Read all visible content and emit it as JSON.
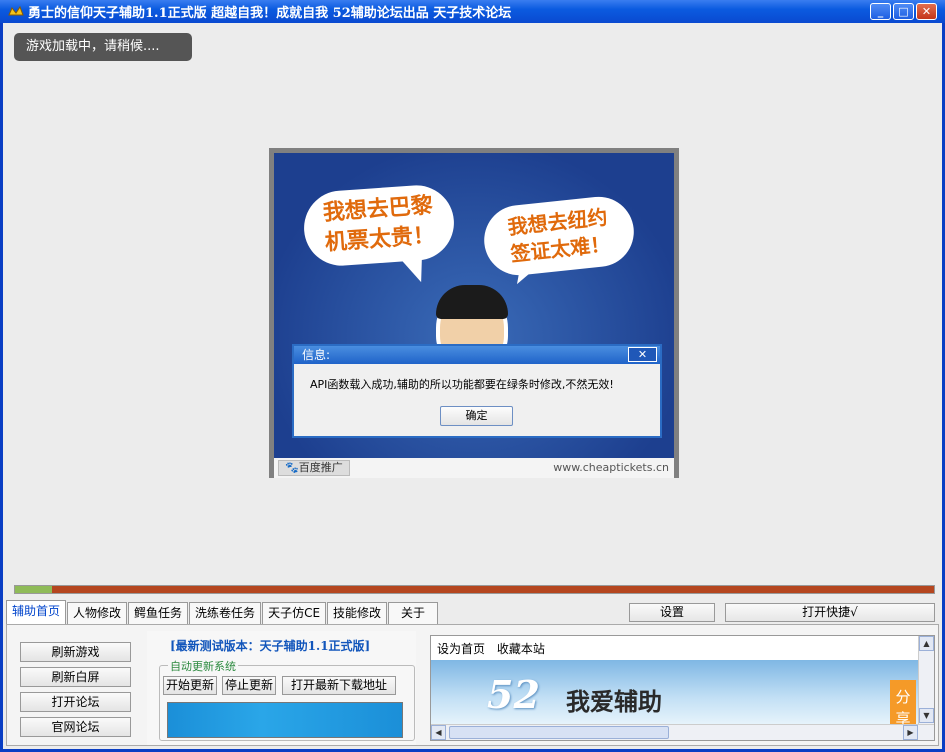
{
  "window": {
    "title": "勇士的信仰天子辅助1.1正式版  超越自我！成就自我   52辅助论坛出品   天子技术论坛",
    "minimize": "_",
    "maximize": "□",
    "close": "✕"
  },
  "loading_tip": "游戏加载中，请稍候....",
  "ad": {
    "bubble1_line1": "我想去巴黎",
    "bubble1_line2": "机票太贵！",
    "bubble2_line1": "我想去纽约",
    "bubble2_line2": "签证太难！",
    "baidu_tag": "🐾百度推广",
    "url": "www.cheaptickets.cn"
  },
  "dialog": {
    "title": "信息:",
    "close": "✕",
    "message": "API函数载入成功,辅助的所以功能都要在绿条时修改,不然无效!",
    "ok": "确定"
  },
  "progress": {
    "value": 0.04
  },
  "tabs": [
    "辅助首页",
    "人物修改",
    "鳄鱼任务",
    "洗练卷任务",
    "天子仿CE",
    "技能修改",
    "关于"
  ],
  "top_buttons": {
    "settings": "设置",
    "hotkey": "打开快捷√"
  },
  "left_buttons": [
    "刷新游戏",
    "刷新白屏",
    "打开论坛",
    "官网论坛"
  ],
  "middle": {
    "title": "[最新测试版本：天子辅助1.1正式版]",
    "group_label": "自动更新系统",
    "start": "开始更新",
    "stop": "停止更新",
    "open_download": "打开最新下载地址"
  },
  "web": {
    "set_home": "设为首页",
    "bookmark": "收藏本站",
    "logo_number": "52",
    "slogan": "我爱辅助",
    "share": "分享"
  }
}
